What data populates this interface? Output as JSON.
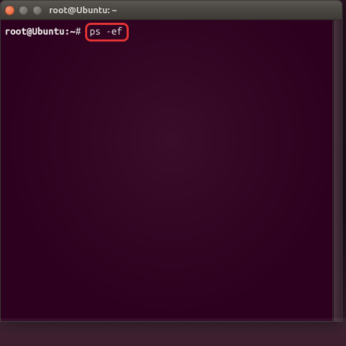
{
  "window": {
    "title": "root@Ubuntu: ~"
  },
  "terminal": {
    "prompt_userhost": "root@Ubuntu:",
    "prompt_path": "~",
    "prompt_symbol": "# ",
    "command": "ps -ef"
  }
}
